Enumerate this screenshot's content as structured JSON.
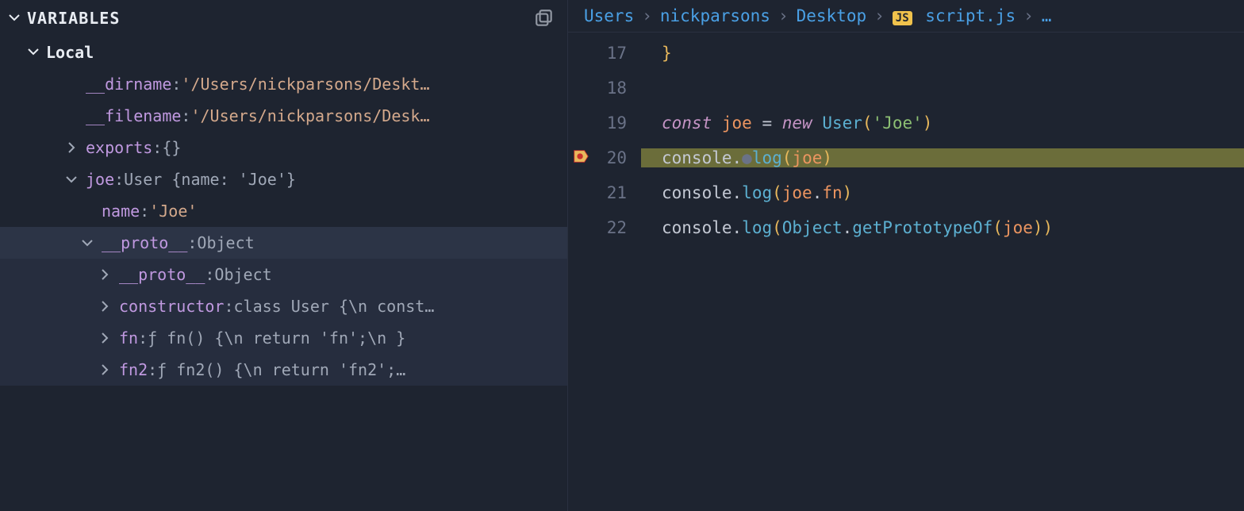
{
  "variables_panel": {
    "title": "VARIABLES",
    "scopes": [
      {
        "name": "Local",
        "vars": [
          {
            "name": "__dirname",
            "value": "'/Users/nickparsons/Deskt…",
            "type": "string",
            "expandable": false
          },
          {
            "name": "__filename",
            "value": "'/Users/nickparsons/Desk…",
            "type": "string",
            "expandable": false
          },
          {
            "name": "exports",
            "value": "{}",
            "type": "object",
            "expandable": true,
            "expanded": false
          },
          {
            "name": "joe",
            "value": "User {name: 'Joe'}",
            "type": "object",
            "expandable": true,
            "expanded": true,
            "children": [
              {
                "name": "name",
                "value": "'Joe'",
                "type": "string",
                "expandable": false
              },
              {
                "name": "__proto__",
                "value": "Object",
                "type": "object",
                "expandable": true,
                "expanded": true,
                "highlight": true,
                "children": [
                  {
                    "name": "__proto__",
                    "value": "Object",
                    "type": "object",
                    "expandable": true,
                    "expanded": false
                  },
                  {
                    "name": "constructor",
                    "value": "class User {\\n  const…",
                    "type": "function",
                    "expandable": true,
                    "expanded": false
                  },
                  {
                    "name": "fn",
                    "value": "ƒ fn() {\\n    return 'fn';\\n  }",
                    "type": "function",
                    "expandable": true,
                    "expanded": false
                  },
                  {
                    "name": "fn2",
                    "value": "ƒ fn2() {\\n    return 'fn2';…",
                    "type": "function",
                    "expandable": true,
                    "expanded": false
                  }
                ]
              }
            ]
          }
        ]
      }
    ]
  },
  "breadcrumb": {
    "items": [
      "Users",
      "nickparsons",
      "Desktop",
      "script.js"
    ],
    "file_badge": "JS",
    "overflow": "…"
  },
  "code": {
    "lines": [
      {
        "num": 17,
        "tokens": [
          {
            "t": "brace",
            "v": "}"
          }
        ]
      },
      {
        "num": 18,
        "tokens": []
      },
      {
        "num": 19,
        "tokens": [
          {
            "t": "key",
            "v": "const "
          },
          {
            "t": "var",
            "v": "joe"
          },
          {
            "t": "op",
            "v": " = "
          },
          {
            "t": "new",
            "v": "new "
          },
          {
            "t": "class",
            "v": "User"
          },
          {
            "t": "paren",
            "v": "("
          },
          {
            "t": "str",
            "v": "'Joe'"
          },
          {
            "t": "paren",
            "v": ")"
          }
        ]
      },
      {
        "num": 20,
        "breakpoint": true,
        "highlight": true,
        "tokens": [
          {
            "t": "obj",
            "v": "console"
          },
          {
            "t": "dot",
            "v": "."
          },
          {
            "t": "dimdot",
            "v": "●"
          },
          {
            "t": "fn",
            "v": "log"
          },
          {
            "t": "paren",
            "v": "("
          },
          {
            "t": "var",
            "v": "joe"
          },
          {
            "t": "paren",
            "v": ")"
          }
        ]
      },
      {
        "num": 21,
        "tokens": [
          {
            "t": "obj",
            "v": "console"
          },
          {
            "t": "dot",
            "v": "."
          },
          {
            "t": "fn",
            "v": "log"
          },
          {
            "t": "paren",
            "v": "("
          },
          {
            "t": "var",
            "v": "joe"
          },
          {
            "t": "dot",
            "v": "."
          },
          {
            "t": "var",
            "v": "fn"
          },
          {
            "t": "paren",
            "v": ")"
          }
        ]
      },
      {
        "num": 22,
        "tokens": [
          {
            "t": "obj",
            "v": "console"
          },
          {
            "t": "dot",
            "v": "."
          },
          {
            "t": "fn",
            "v": "log"
          },
          {
            "t": "paren",
            "v": "("
          },
          {
            "t": "class",
            "v": "Object"
          },
          {
            "t": "dot",
            "v": "."
          },
          {
            "t": "fn",
            "v": "getPrototypeOf"
          },
          {
            "t": "paren",
            "v": "("
          },
          {
            "t": "var",
            "v": "joe"
          },
          {
            "t": "paren",
            "v": ")"
          },
          {
            "t": "paren",
            "v": ")"
          }
        ]
      }
    ]
  }
}
